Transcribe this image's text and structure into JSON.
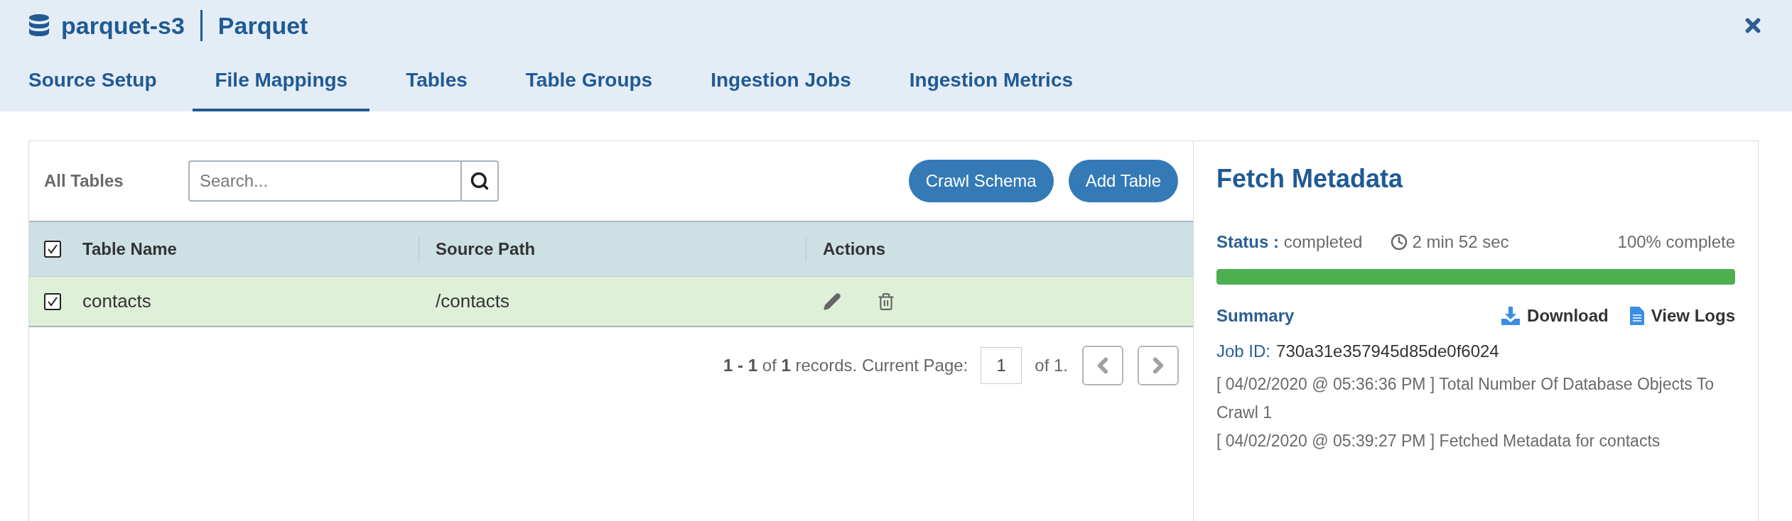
{
  "header": {
    "title": "parquet-s3",
    "subtitle": "Parquet"
  },
  "tabs": [
    {
      "label": "Source Setup",
      "selected": false
    },
    {
      "label": "File Mappings",
      "selected": true
    },
    {
      "label": "Tables",
      "selected": false
    },
    {
      "label": "Table Groups",
      "selected": false
    },
    {
      "label": "Ingestion Jobs",
      "selected": false
    },
    {
      "label": "Ingestion Metrics",
      "selected": false
    }
  ],
  "table_panel": {
    "title": "All Tables",
    "search": {
      "placeholder": "Search..."
    },
    "buttons": [
      "Crawl Schema",
      "Add Table"
    ],
    "header_checked": true,
    "columns": [
      "Table Name",
      "Source Path",
      "Actions"
    ],
    "rows": [
      {
        "name": "contacts",
        "source_path": "/contacts",
        "checked": true
      }
    ],
    "pagination": {
      "summary": "**1 - 1** of **1** records. Current Page:",
      "page": "1",
      "total": "of 1."
    }
  },
  "metadata": {
    "title": "Fetch Metadata",
    "status_label": "Status :",
    "status": "completed",
    "duration": "2 min 52 sec",
    "progress_text": "100% complete",
    "level": 1,
    "summary": "Summary",
    "actions": [
      "Download",
      "View Logs"
    ],
    "job_id_label": "Job ID:",
    "job_id": "730a31e357945d85de0f6024",
    "logs": [
      "[ 04/02/2020 @ 05:36:36 PM ] Total Number Of Database Objects To Crawl 1",
      "[ 04/02/2020 @ 05:39:27 PM ] Fetched Metadata for contacts"
    ]
  }
}
